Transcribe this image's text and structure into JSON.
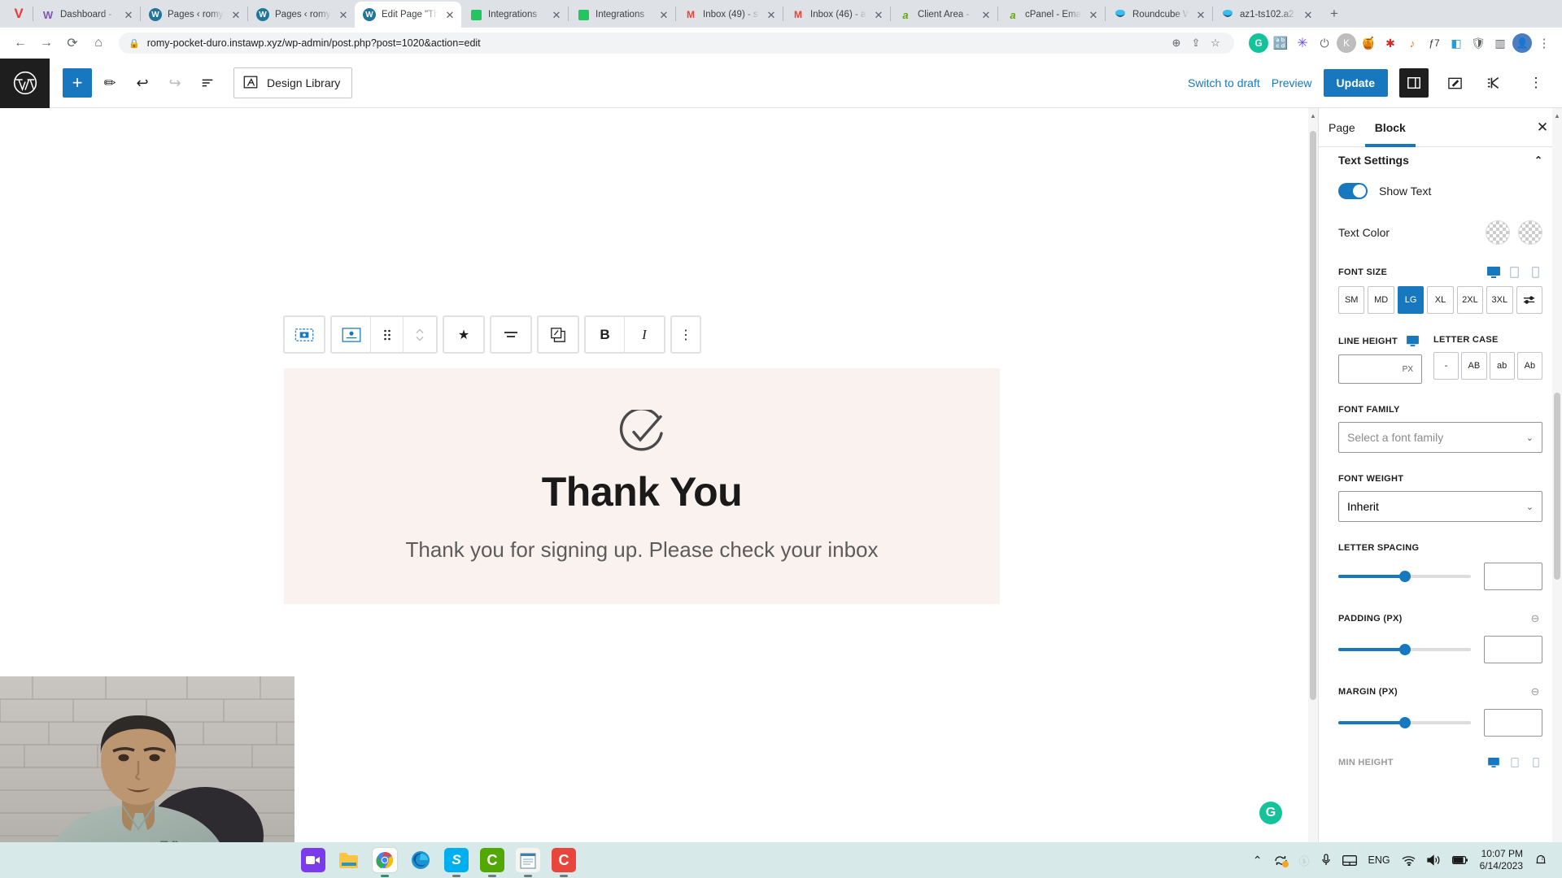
{
  "browser": {
    "tabs": [
      {
        "title": "Dashboard -",
        "favicon": "woocommerce-icon",
        "active": false
      },
      {
        "title": "Pages ‹ romy",
        "favicon": "wordpress-icon",
        "active": false
      },
      {
        "title": "Pages ‹ romy",
        "favicon": "wordpress-icon",
        "active": false
      },
      {
        "title": "Edit Page \"Th",
        "favicon": "wordpress-icon",
        "active": true
      },
      {
        "title": "Integrations",
        "favicon": "green-square-icon",
        "active": false
      },
      {
        "title": "Integrations",
        "favicon": "green-square-icon",
        "active": false
      },
      {
        "title": "Inbox (49) - s",
        "favicon": "gmail-icon",
        "active": false
      },
      {
        "title": "Inbox (46) - a",
        "favicon": "gmail-icon",
        "active": false
      },
      {
        "title": "Client Area -",
        "favicon": "a2hosting-icon",
        "active": false
      },
      {
        "title": "cPanel - Ema",
        "favicon": "a2hosting-icon",
        "active": false
      },
      {
        "title": "Roundcube W",
        "favicon": "roundcube-icon",
        "active": false
      },
      {
        "title": "az1-ts102.a2",
        "favicon": "roundcube-icon",
        "active": false
      }
    ],
    "new_tab_label": "+",
    "url": "romy-pocket-duro.instawp.xyz/wp-admin/post.php?post=1020&action=edit",
    "lock_icon": "lock-icon",
    "nav": {
      "back": "back-arrow-icon",
      "forward": "forward-arrow-icon",
      "reload": "reload-icon",
      "home": "home-icon"
    },
    "url_actions": [
      "zoom-in-icon",
      "share-icon",
      "bookmark-star-icon"
    ],
    "extensions": [
      "grammarly-icon",
      "translate-icon",
      "asterisk-icon",
      "power-icon",
      "kaspersky-icon",
      "honey-icon",
      "lastpass-icon",
      "music-icon",
      "j7-icon",
      "toolbox-icon",
      "shield-icon",
      "sidebar-icon",
      "profile-avatar-icon",
      "menu-icon"
    ]
  },
  "editor": {
    "logo": "wordpress-logo",
    "toolbar_left": {
      "add_block": "+",
      "tools_icon": "pencil-icon",
      "undo_icon": "undo-icon",
      "redo_icon": "redo-icon",
      "list_view_icon": "document-overview-icon",
      "design_library_label": "Design Library",
      "design_library_icon": "design-library-icon"
    },
    "toolbar_right": {
      "switch_to_draft": "Switch to draft",
      "preview": "Preview",
      "update": "Update",
      "settings_icon": "settings-sidebar-icon",
      "edit_icon": "edit-mode-icon",
      "kadence_icon": "kadence-icon",
      "options_icon": "three-dots-icon"
    },
    "block_toolbar": {
      "parent_icon": "select-parent-block-icon",
      "block_type_icon": "icon-box-block-icon",
      "drag_icon": "drag-handle-icon",
      "move_icon": "move-up-down-icon",
      "star_icon": "star-icon",
      "align_icon": "align-text-center-icon",
      "duplicate_icon": "duplicate-icon",
      "bold_label": "B",
      "italic_label": "I",
      "more_icon": "three-dots-vertical-icon"
    },
    "content": {
      "check_icon": "check-circle-icon",
      "heading": "Thank You",
      "subtext": "Thank you for signing up. Please check your inbox",
      "background_color": "#faf2ef"
    },
    "grammarly_fab": "G"
  },
  "sidebar": {
    "tabs": [
      {
        "label": "Page",
        "active": false
      },
      {
        "label": "Block",
        "active": true
      }
    ],
    "close_icon": "close-icon",
    "panel_title": "Text Settings",
    "collapse_icon": "chevron-up-icon",
    "show_text": {
      "label": "Show Text",
      "enabled": true
    },
    "text_color": {
      "label": "Text Color",
      "swatches": [
        "transparent",
        "transparent"
      ]
    },
    "font_size": {
      "label": "Font Size",
      "devices": [
        "desktop-icon",
        "tablet-icon",
        "mobile-icon"
      ],
      "active_device": "desktop-icon",
      "options": [
        "SM",
        "MD",
        "LG",
        "XL",
        "2XL",
        "3XL"
      ],
      "selected": "LG",
      "custom_icon": "sliders-icon"
    },
    "line_height": {
      "label": "Line Height",
      "device_icon": "desktop-icon",
      "value": "",
      "unit": "PX"
    },
    "letter_case": {
      "label": "Letter Case",
      "options": [
        "-",
        "AB",
        "ab",
        "Ab"
      ],
      "selected": ""
    },
    "font_family": {
      "label": "Font Family",
      "placeholder": "Select a font family",
      "value": ""
    },
    "font_weight": {
      "label": "Font Weight",
      "value": "Inherit"
    },
    "letter_spacing": {
      "label": "Letter Spacing",
      "slider_percent": 50,
      "value": ""
    },
    "padding": {
      "label": "Padding (PX)",
      "link_icon": "link-sides-icon",
      "slider_percent": 50,
      "value": ""
    },
    "margin": {
      "label": "Margin (PX)",
      "link_icon": "link-sides-icon",
      "slider_percent": 50,
      "value": ""
    },
    "min_height_partial": "Min Height"
  },
  "taskbar": {
    "apps": [
      "meet-icon",
      "file-explorer-icon",
      "chrome-icon",
      "edge-icon",
      "skype-icon",
      "camtasia-icon",
      "notepad-icon",
      "camtasia-recorder-icon"
    ],
    "tray": [
      "chevron-up-icon",
      "onedrive-sync-icon",
      "skype-tray-icon",
      "microphone-icon",
      "touchpad-icon",
      "language-ENG",
      "wifi-icon",
      "volume-icon",
      "battery-icon",
      "notification-icon"
    ],
    "language": "ENG",
    "time": "10:07 PM",
    "date": "6/14/2023"
  }
}
